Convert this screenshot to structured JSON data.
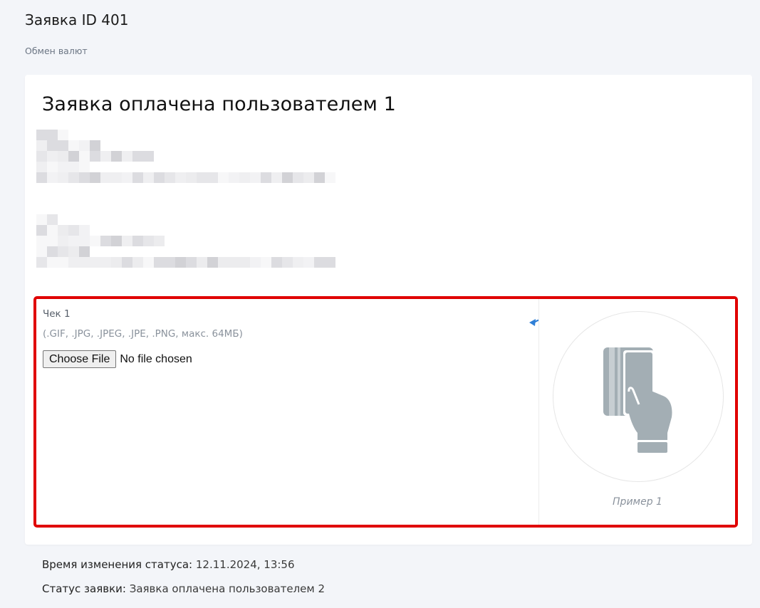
{
  "header": {
    "title": "Заявка ID 401",
    "subtitle": "Обмен валют"
  },
  "card": {
    "title": "Заявка оплачена пользователем 1",
    "blurred_details": "redacted"
  },
  "upload": {
    "label": "Чек 1",
    "hint": "(.GIF, .JPG, .JPEG, .JPE, .PNG, макс. 64МБ)",
    "button_label": "Choose File",
    "file_status": "No file chosen",
    "example_caption": "Пример 1",
    "rotate_icon": "rotate-left-icon",
    "example_icon": "card-in-hand-icon",
    "highlight_color": "#e00000"
  },
  "status": {
    "time_label": "Время изменения статуса:",
    "time_value": "12.11.2024, 13:56",
    "status_label": "Статус заявки:",
    "status_value": "Заявка оплачена пользователем 2"
  }
}
